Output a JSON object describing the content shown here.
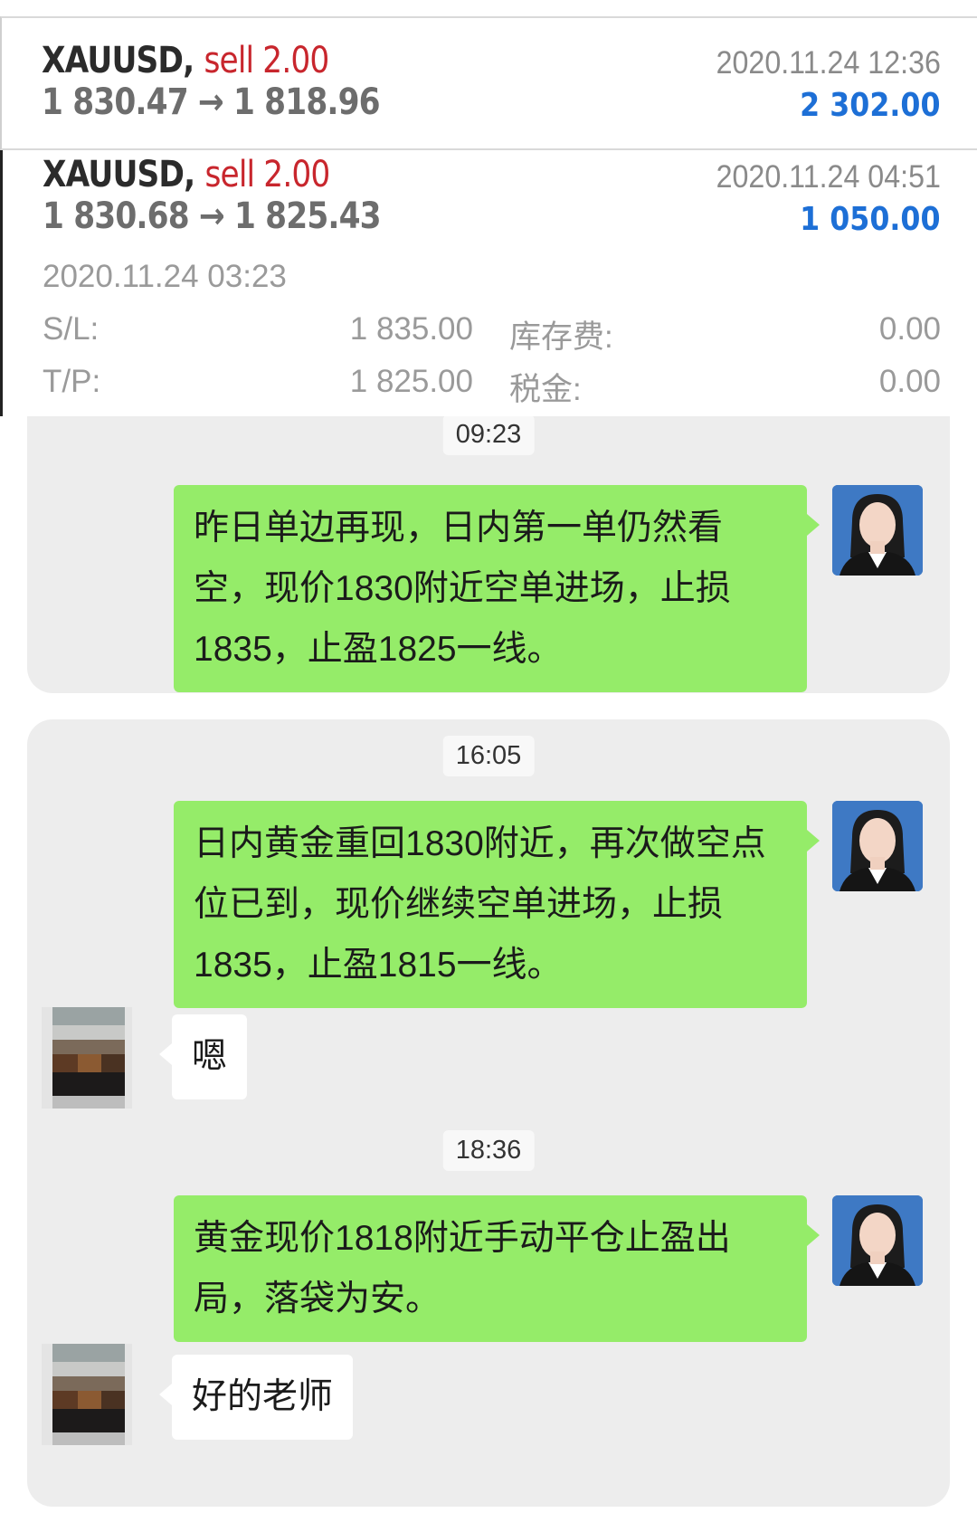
{
  "trades": [
    {
      "symbol": "XAUUSD,",
      "side": "sell 2.00",
      "prices": "1 830.47 → 1 818.96",
      "date": "2020.11.24 12:36",
      "profit": "2 302.00"
    },
    {
      "symbol": "XAUUSD,",
      "side": "sell 2.00",
      "prices": "1 830.68 → 1 825.43",
      "date": "2020.11.24 04:51",
      "profit": "1 050.00",
      "open_time": "2020.11.24 03:23",
      "details": {
        "sl_label": "S/L:",
        "sl_value": "1 835.00",
        "tp_label": "T/P:",
        "tp_value": "1 825.00",
        "swap_label": "库存费:",
        "swap_value": "0.00",
        "tax_label": "税金:",
        "tax_value": "0.00"
      }
    }
  ],
  "chat": {
    "block1": {
      "time": "09:23",
      "msg1": "昨日单边再现，日内第一单仍然看空，现价1830附近空单进场，止损1835，止盈1825一线。"
    },
    "block2": {
      "time1": "16:05",
      "msg1": "日内黄金重回1830附近，再次做空点位已到，现价继续空单进场，止损1835，止盈1815一线。",
      "reply1": "嗯",
      "time2": "18:36",
      "msg2": "黄金现价1818附近手动平仓止盈出局，落袋为安。",
      "reply2": "好的老师"
    }
  },
  "colors": {
    "sell": "#c8262d",
    "profit": "#1d6fd6",
    "outgoing_bubble": "#95ec69",
    "chat_bg": "#ededed"
  },
  "icons": {
    "teacher_avatar": "teacher-avatar-icon",
    "user_avatar": "user-avatar-icon"
  }
}
